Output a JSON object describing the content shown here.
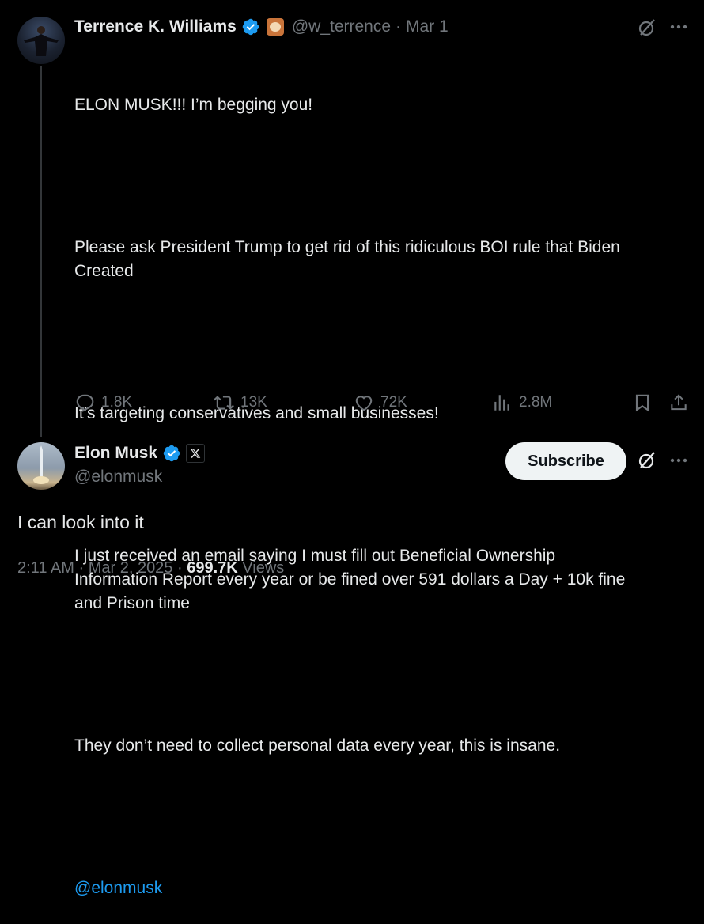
{
  "parent_tweet": {
    "author_name": "Terrence K. Williams",
    "handle": "@w_terrence",
    "separator": "·",
    "date": "Mar 1",
    "lines": [
      "ELON MUSK!!! I’m begging you!",
      "Please ask President Trump to get rid of this ridiculous BOI rule that Biden\nCreated",
      "It’s targeting conservatives and small businesses!",
      "I just received an email saying I must fill out Beneficial Ownership\nInformation Report every year or be fined over 591 dollars a Day + 10k fine\nand Prison time",
      "They don’t need to collect personal data every year, this is insane."
    ],
    "mention": "@elonmusk",
    "stats": {
      "replies": "1.8K",
      "reposts": "13K",
      "likes": "72K",
      "views": "2.8M"
    }
  },
  "main_tweet": {
    "author_name": "Elon Musk",
    "handle": "@elonmusk",
    "subscribe_label": "Subscribe",
    "text": "I can look into it",
    "time": "2:11 AM",
    "separator1": "·",
    "date": "Mar 2, 2025",
    "separator2": "·",
    "views_count": "699.7K",
    "views_label": "Views"
  },
  "colors": {
    "background": "#000000",
    "text_primary": "#e7e9ea",
    "text_secondary": "#71767b",
    "link": "#1d9bf0",
    "verified": "#1d9bf0"
  },
  "icons": [
    "verified-badge-icon",
    "emoji-badge-icon",
    "grok-icon",
    "more-icon",
    "reply-icon",
    "repost-icon",
    "like-icon",
    "views-icon",
    "bookmark-icon",
    "share-icon",
    "x-affiliate-icon"
  ]
}
